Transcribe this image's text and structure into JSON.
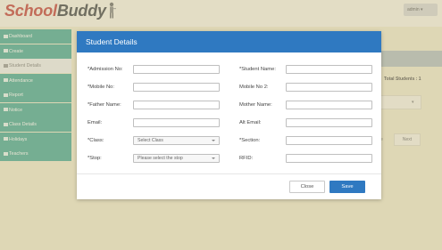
{
  "app": {
    "logo_school": "School",
    "logo_buddy": "Buddy",
    "user_menu": "admin ▾"
  },
  "sidebar": {
    "items": [
      {
        "label": "Dashboard"
      },
      {
        "label": "Create"
      },
      {
        "label": "Student Details"
      },
      {
        "label": "Attendance"
      },
      {
        "label": "Report"
      },
      {
        "label": "Notice"
      },
      {
        "label": "Class Details"
      },
      {
        "label": "Holidays"
      },
      {
        "label": "Teachers"
      }
    ]
  },
  "background": {
    "total_students_label": "Total Students : 1",
    "prev_label": "e",
    "next_label": "Next"
  },
  "modal": {
    "title": "Student Details",
    "fields": {
      "admission_no": {
        "label": "*Admission No:",
        "value": ""
      },
      "student_name": {
        "label": "*Student Name:",
        "value": ""
      },
      "mobile_no": {
        "label": "*Mobile No:",
        "value": ""
      },
      "mobile_no_2": {
        "label": "Mobile No 2:",
        "value": ""
      },
      "father_name": {
        "label": "*Father Name:",
        "value": ""
      },
      "mother_name": {
        "label": "Mother Name:",
        "value": ""
      },
      "email": {
        "label": "Email:",
        "value": ""
      },
      "alt_email": {
        "label": "Alt Email:",
        "value": ""
      },
      "class": {
        "label": "*Class:",
        "selected": "Select Class"
      },
      "section": {
        "label": "*Section:",
        "value": ""
      },
      "stop": {
        "label": "*Stop:",
        "selected": "Please select the stop"
      },
      "rfid": {
        "label": "RFID:",
        "value": ""
      }
    },
    "close_label": "Close",
    "save_label": "Save"
  },
  "colors": {
    "header_blue": "#2f79c1",
    "sidebar_teal": "#2d9b87",
    "logo_red": "#b8231f"
  }
}
